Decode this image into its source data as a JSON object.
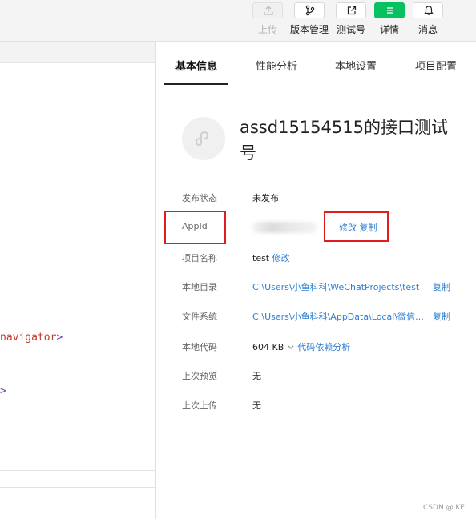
{
  "toolbar": {
    "upload": {
      "label": "上传",
      "icon": "upload-icon",
      "state": "disabled"
    },
    "version": {
      "label": "版本管理",
      "icon": "branch-icon"
    },
    "test": {
      "label": "测试号",
      "icon": "external-link-icon"
    },
    "details": {
      "label": "详情",
      "icon": "menu-icon",
      "state": "active",
      "color": "#07c160"
    },
    "messages": {
      "label": "消息",
      "icon": "bell-icon"
    }
  },
  "editor": {
    "line1": {
      "text": "navigator",
      "close": ">"
    },
    "line2": {
      "close": ">"
    }
  },
  "panel": {
    "tabs": [
      "基本信息",
      "性能分析",
      "本地设置",
      "项目配置"
    ],
    "active_tab": "基本信息",
    "title": "assd15154515的接口测试号",
    "info": {
      "publish_status": {
        "key": "发布状态",
        "value": "未发布"
      },
      "appid": {
        "key": "AppId",
        "edit": "修改",
        "copy": "复制"
      },
      "name": {
        "key": "项目名称",
        "value": "test",
        "edit": "修改"
      },
      "local_dir": {
        "key": "本地目录",
        "value": "C:\\Users\\小鱼科科\\WeChatProjects\\test",
        "copy": "复制"
      },
      "file_system": {
        "key": "文件系统",
        "value": "C:\\Users\\小鱼科科\\AppData\\Local\\微信开发...",
        "copy": "复制"
      },
      "local_code": {
        "key": "本地代码",
        "size": "604 KB",
        "link": "代码依赖分析"
      },
      "last_preview": {
        "key": "上次预览",
        "value": "无"
      },
      "last_upload": {
        "key": "上次上传",
        "value": "无"
      }
    }
  },
  "watermark": "CSDN @.KE",
  "colors": {
    "accent": "#07c160",
    "link": "#2f7fd0",
    "highlight": "#e01c1c"
  }
}
